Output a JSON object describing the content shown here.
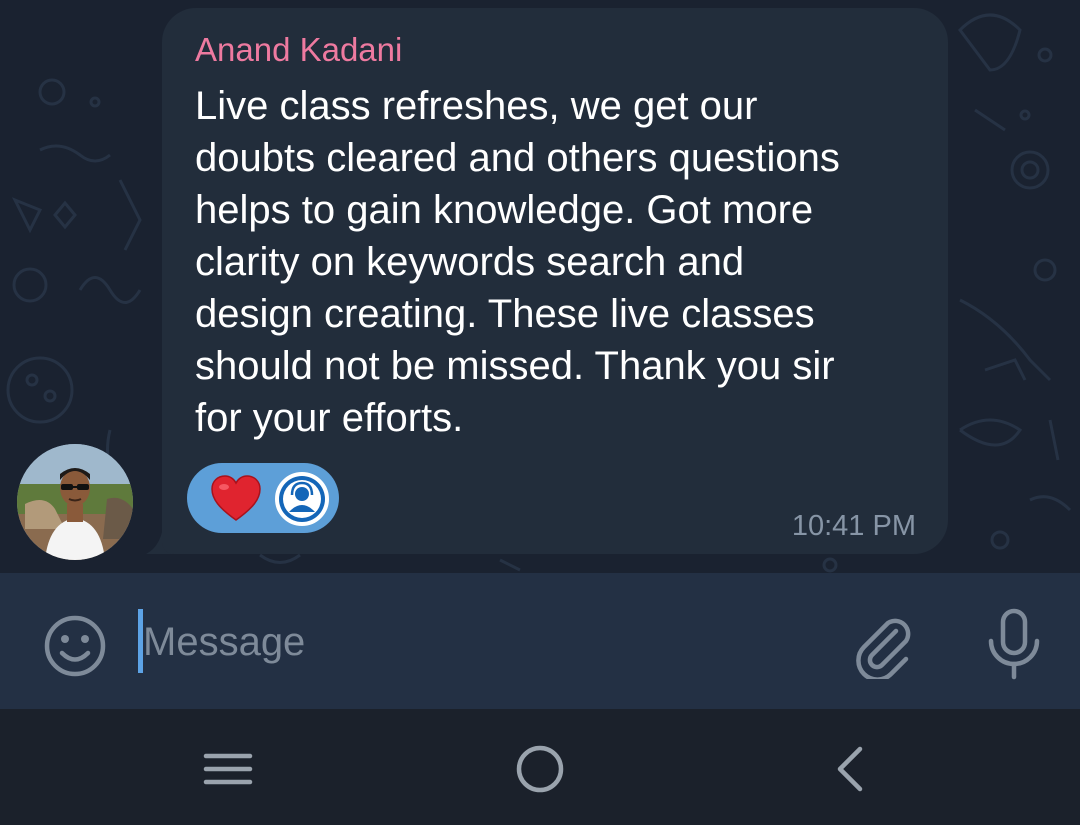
{
  "message": {
    "sender": "Anand Kadani",
    "text": "Live class refreshes, we get our\ndoubts cleared and others questions\nhelps to gain knowledge. Got more\nclarity on keywords search and\ndesign creating. These live classes\nshould not be missed. Thank you sir\nfor your efforts.",
    "time": "10:41 PM",
    "reactions": [
      "heart-emoji",
      "user-avatar"
    ]
  },
  "input": {
    "placeholder": "Message"
  },
  "icons": {
    "emoji": "smiley-face-icon",
    "attach": "paperclip-icon",
    "mic": "microphone-icon",
    "nav_recent": "menu-lines-icon",
    "nav_home": "circle-home-icon",
    "nav_back": "chevron-left-icon"
  },
  "colors": {
    "chat_background": "#1a2230",
    "bubble": "#222d3b",
    "sender_name": "#ee7aa0",
    "timestamp": "#8795a6",
    "reaction_pill": "#5d9fd8",
    "input_bar": "#233044",
    "caret": "#5da3e6",
    "nav_bar": "#1b212b"
  }
}
